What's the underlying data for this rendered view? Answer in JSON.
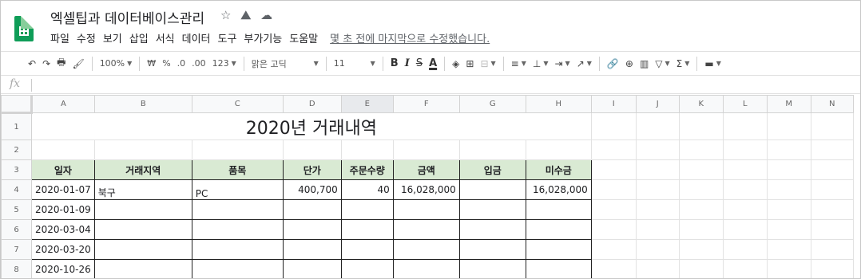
{
  "doc": {
    "title": "엑셀팁과 데이터베이스관리",
    "star_icon": "star-icon",
    "move_icon": "move-to-drive-icon",
    "cloud_icon": "cloud-status-icon"
  },
  "menu": [
    "파일",
    "수정",
    "보기",
    "삽입",
    "서식",
    "데이터",
    "도구",
    "부가기능",
    "도움말"
  ],
  "last_edit": "몇 초 전에 마지막으로 수정했습니다.",
  "toolbar": {
    "zoom": "100%",
    "currency": "₩",
    "percent": "%",
    "dec_less": ".0",
    "dec_more": ".00",
    "format_more": "123",
    "font": "맑은 고딕",
    "font_size": "11",
    "bold": "B",
    "italic": "I",
    "strike": "S",
    "text_color": "A"
  },
  "formula_bar": {
    "fx": "fx",
    "value": ""
  },
  "columns": [
    "A",
    "B",
    "C",
    "D",
    "E",
    "F",
    "G",
    "H",
    "I",
    "J",
    "K",
    "L",
    "M",
    "N"
  ],
  "sheet": {
    "title": "2020년 거래내역",
    "headers": [
      "일자",
      "거래지역",
      "품목",
      "단가",
      "주문수량",
      "금액",
      "입금",
      "미수금"
    ],
    "rows": [
      [
        "2020-01-07",
        "북구",
        "PC",
        "400,700",
        "40",
        "16,028,000",
        "",
        "16,028,000"
      ],
      [
        "2020-01-09",
        "",
        "",
        "",
        "",
        "",
        "",
        ""
      ],
      [
        "2020-03-04",
        "",
        "",
        "",
        "",
        "",
        "",
        ""
      ],
      [
        "2020-03-20",
        "",
        "",
        "",
        "",
        "",
        "",
        ""
      ],
      [
        "2020-10-26",
        "",
        "",
        "",
        "",
        "",
        "",
        ""
      ]
    ]
  },
  "row_numbers": [
    "1",
    "2",
    "3",
    "4",
    "5",
    "6",
    "7",
    "8"
  ],
  "colors": {
    "header_fill": "#d9ead3",
    "sheets_green": "#0f9d58"
  }
}
